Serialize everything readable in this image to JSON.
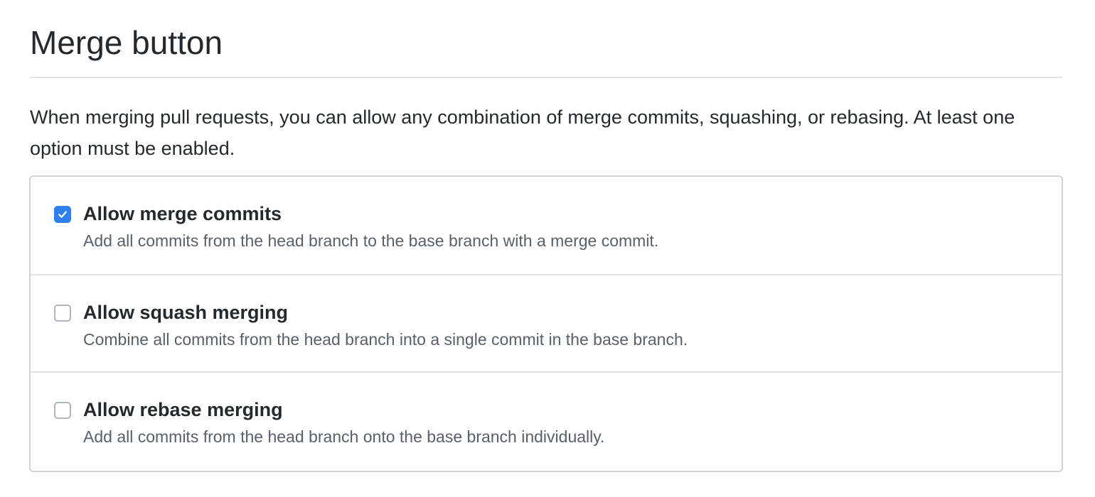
{
  "section": {
    "title": "Merge button",
    "description": "When merging pull requests, you can allow any combination of merge commits, squashing, or rebasing. At least one option must be enabled."
  },
  "options": [
    {
      "label": "Allow merge commits",
      "description": "Add all commits from the head branch to the base branch with a merge commit.",
      "checked": true
    },
    {
      "label": "Allow squash merging",
      "description": "Combine all commits from the head branch into a single commit in the base branch.",
      "checked": false
    },
    {
      "label": "Allow rebase merging",
      "description": "Add all commits from the head branch onto the base branch individually.",
      "checked": false
    }
  ],
  "colors": {
    "checkbox_checked": "#2f80ed",
    "heading_text": "#24292e",
    "description_text": "#586069",
    "border": "#d1d5da"
  },
  "icons": {
    "checked_mark": "checkmark-icon"
  }
}
